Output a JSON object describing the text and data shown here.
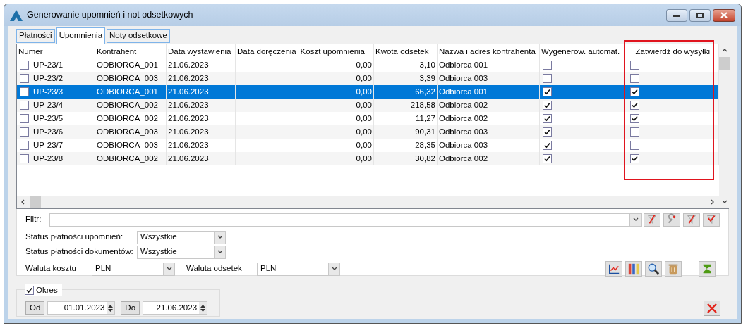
{
  "window": {
    "title": "Generowanie upomnień i not odsetkowych"
  },
  "tabs": [
    {
      "label": "Płatności",
      "selected": false
    },
    {
      "label": "Upomnienia",
      "selected": true
    },
    {
      "label": "Noty odsetkowe",
      "selected": false
    }
  ],
  "table": {
    "columns": [
      {
        "label": "Numer",
        "highlighted": false
      },
      {
        "label": "Kontrahent",
        "highlighted": false
      },
      {
        "label": "Data wystawienia",
        "highlighted": false
      },
      {
        "label": "Data doręczenia",
        "highlighted": false
      },
      {
        "label": "Koszt upomnienia",
        "highlighted": false
      },
      {
        "label": "Kwota odsetek",
        "highlighted": false
      },
      {
        "label": "Nazwa i adres kontrahenta",
        "highlighted": false
      },
      {
        "label": "Wygenerow. automat.",
        "highlighted": false
      },
      {
        "label": "Zatwierdź do wysyłki",
        "highlighted": true
      }
    ],
    "rows": [
      {
        "selected": false,
        "checked": false,
        "numer": "UP-23/1",
        "kontrahent": "ODBIORCA_001",
        "data_wystawienia": "21.06.2023",
        "koszt": "0,00",
        "kwota": "3,10",
        "nazwa": "Odbiorca 001",
        "wygenerowany": false,
        "zatwierdz": false
      },
      {
        "selected": false,
        "checked": false,
        "numer": "UP-23/2",
        "kontrahent": "ODBIORCA_003",
        "data_wystawienia": "21.06.2023",
        "koszt": "0,00",
        "kwota": "3,39",
        "nazwa": "Odbiorca 003",
        "wygenerowany": false,
        "zatwierdz": false
      },
      {
        "selected": true,
        "checked": false,
        "numer": "UP-23/3",
        "kontrahent": "ODBIORCA_001",
        "data_wystawienia": "21.06.2023",
        "koszt": "0,00",
        "kwota": "66,32",
        "nazwa": "Odbiorca 001",
        "wygenerowany": true,
        "zatwierdz": true
      },
      {
        "selected": false,
        "checked": false,
        "numer": "UP-23/4",
        "kontrahent": "ODBIORCA_002",
        "data_wystawienia": "21.06.2023",
        "koszt": "0,00",
        "kwota": "218,58",
        "nazwa": "Odbiorca 002",
        "wygenerowany": true,
        "zatwierdz": true
      },
      {
        "selected": false,
        "checked": false,
        "numer": "UP-23/5",
        "kontrahent": "ODBIORCA_002",
        "data_wystawienia": "21.06.2023",
        "koszt": "0,00",
        "kwota": "11,27",
        "nazwa": "Odbiorca 002",
        "wygenerowany": true,
        "zatwierdz": true
      },
      {
        "selected": false,
        "checked": false,
        "numer": "UP-23/6",
        "kontrahent": "ODBIORCA_003",
        "data_wystawienia": "21.06.2023",
        "koszt": "0,00",
        "kwota": "90,31",
        "nazwa": "Odbiorca 003",
        "wygenerowany": true,
        "zatwierdz": false
      },
      {
        "selected": false,
        "checked": false,
        "numer": "UP-23/7",
        "kontrahent": "ODBIORCA_003",
        "data_wystawienia": "21.06.2023",
        "koszt": "0,00",
        "kwota": "28,35",
        "nazwa": "Odbiorca 003",
        "wygenerowany": true,
        "zatwierdz": false
      },
      {
        "selected": false,
        "checked": false,
        "numer": "UP-23/8",
        "kontrahent": "ODBIORCA_002",
        "data_wystawienia": "21.06.2023",
        "koszt": "0,00",
        "kwota": "30,82",
        "nazwa": "Odbiorca 002",
        "wygenerowany": true,
        "zatwierdz": true
      }
    ]
  },
  "filter": {
    "label": "Filtr:"
  },
  "status_upomnien": {
    "label": "Status płatności upomnień:",
    "value": "Wszystkie"
  },
  "status_dokumentow": {
    "label": "Status płatności dokumentów:",
    "value": "Wszystkie"
  },
  "waluta_kosztu": {
    "label": "Waluta kosztu",
    "value": "PLN"
  },
  "waluta_odsetek": {
    "label": "Waluta odsetek",
    "value": "PLN"
  },
  "okres": {
    "label": "Okres",
    "checked": true,
    "from_button": "Od",
    "from": "01.01.2023",
    "to_button": "Do",
    "to": "21.06.2023"
  }
}
